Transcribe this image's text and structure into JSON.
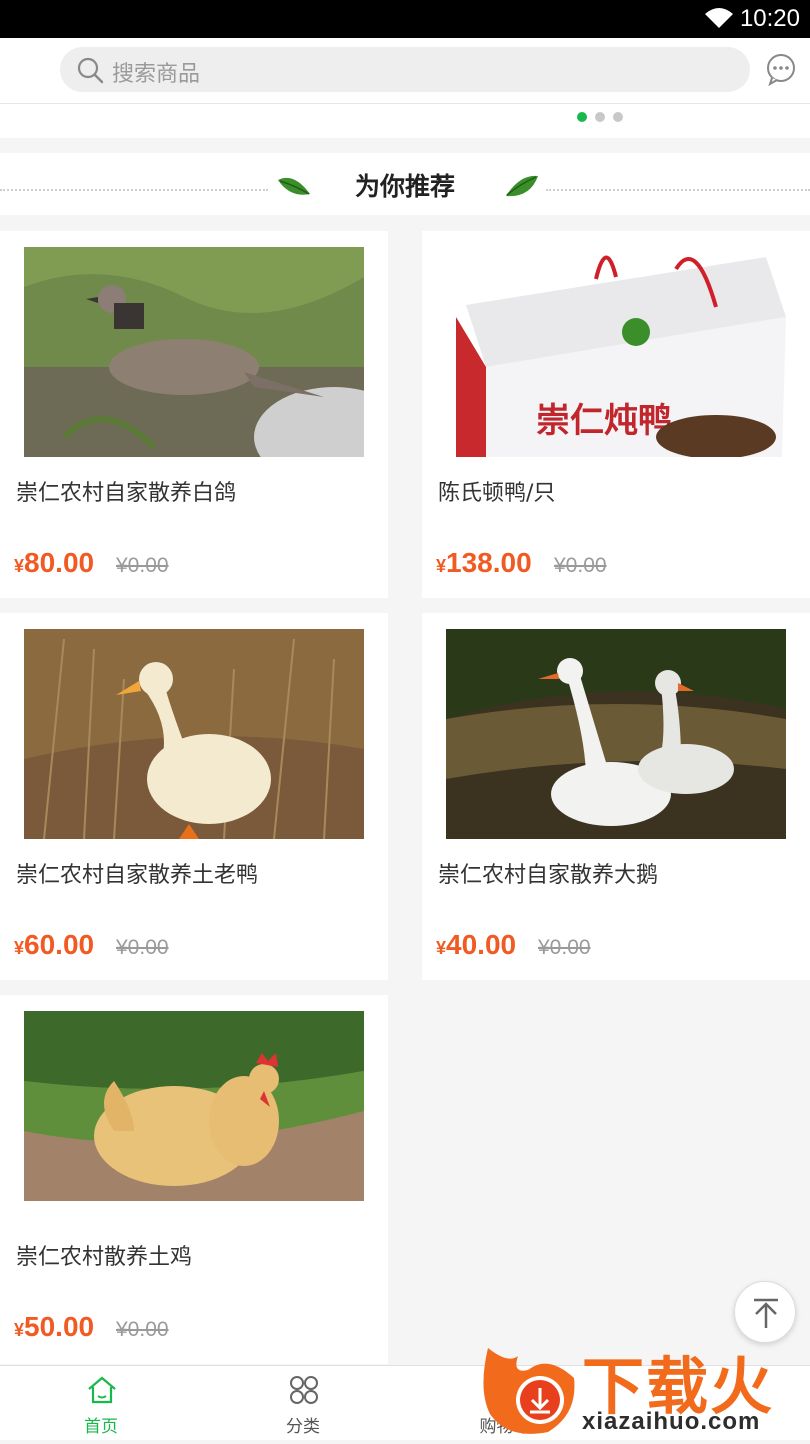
{
  "status_bar": {
    "time": "10:20"
  },
  "search": {
    "placeholder": "搜索商品"
  },
  "banner": {
    "dots": 3,
    "active_index": 0
  },
  "section": {
    "title": "为你推荐"
  },
  "products": [
    {
      "name": "崇仁农村自家散养白鸽",
      "price": "80.00",
      "old_price": "¥0.00",
      "image": "dove-photo"
    },
    {
      "name": "陈氏顿鸭/只",
      "price": "138.00",
      "old_price": "¥0.00",
      "image": "duck-gift-box-photo"
    },
    {
      "name": "崇仁农村自家散养土老鸭",
      "price": "60.00",
      "old_price": "¥0.00",
      "image": "duck-photo"
    },
    {
      "name": "崇仁农村自家散养大鹅",
      "price": "40.00",
      "old_price": "¥0.00",
      "image": "geese-photo"
    },
    {
      "name": "崇仁农村散养土鸡",
      "price": "50.00",
      "old_price": "¥0.00",
      "image": "chicken-photo"
    }
  ],
  "currency_symbol": "¥",
  "box_text": "崇仁炖鸭",
  "tabs": [
    {
      "label": "首页",
      "icon": "home-icon",
      "active": true
    },
    {
      "label": "分类",
      "icon": "category-icon",
      "active": false
    },
    {
      "label": "购物车",
      "icon": "cart-icon",
      "active": false
    }
  ],
  "watermark": {
    "brand": "下载火",
    "url": "xiazaihuo.com"
  },
  "colors": {
    "accent": "#18b94c",
    "price": "#f15a22"
  }
}
